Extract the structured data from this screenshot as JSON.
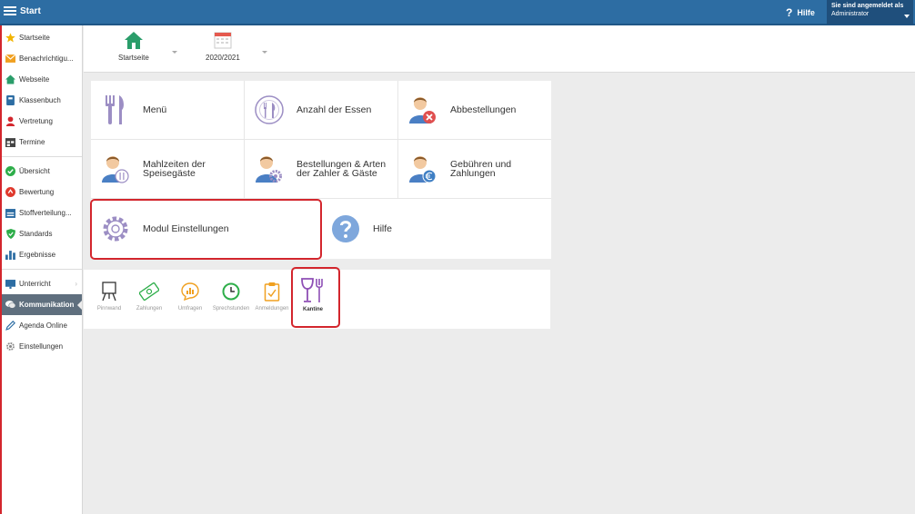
{
  "topbar": {
    "title": "Start",
    "help_label": "Hilfe",
    "help_glyph": "?",
    "user_label": "Sie sind angemeldet als",
    "user_name": "Administrator"
  },
  "sidebar": {
    "items": [
      {
        "label": "Startseite",
        "icon": "star-icon",
        "color": "#f2b400"
      },
      {
        "label": "Benachrichtigu...",
        "icon": "mail-icon",
        "color": "#f0a020"
      },
      {
        "label": "Webseite",
        "icon": "home-icon",
        "color": "#2a9d6a"
      },
      {
        "label": "Klassenbuch",
        "icon": "book-icon",
        "color": "#2d6da3"
      },
      {
        "label": "Vertretung",
        "icon": "person-icon",
        "color": "#d3262d"
      },
      {
        "label": "Termine",
        "icon": "calendar-icon",
        "color": "#444444"
      },
      {
        "label": "Übersicht",
        "icon": "check-circle-icon",
        "color": "#2eae4a"
      },
      {
        "label": "Bewertung",
        "icon": "rating-icon",
        "color": "#e03a2e"
      },
      {
        "label": "Stoffverteilung...",
        "icon": "list-icon",
        "color": "#2d6da3"
      },
      {
        "label": "Standards",
        "icon": "shield-icon",
        "color": "#2eae4a"
      },
      {
        "label": "Ergebnisse",
        "icon": "bar-chart-icon",
        "color": "#2d6da3"
      },
      {
        "label": "Unterricht",
        "icon": "board-icon",
        "color": "#2d6da3"
      },
      {
        "label": "Kommunikation",
        "icon": "chat-icon",
        "color": "#ffffff"
      },
      {
        "label": "Agenda Online",
        "icon": "pen-icon",
        "color": "#2d6da3"
      },
      {
        "label": "Einstellungen",
        "icon": "gear-icon",
        "color": "#888888"
      }
    ],
    "arrow": "›"
  },
  "header": {
    "home_label": "Startseite",
    "year_label": "2020/2021"
  },
  "tiles": [
    {
      "label": "Menü"
    },
    {
      "label": "Anzahl der Essen"
    },
    {
      "label": "Abbestellungen"
    },
    {
      "label": "Mahlzeiten der Speisegäste"
    },
    {
      "label": "Bestellungen & Arten der Zahler & Gäste"
    },
    {
      "label": "Gebühren und Zahlungen"
    },
    {
      "label": "Modul Einstellungen"
    },
    {
      "label": "Hilfe"
    }
  ],
  "apps": [
    {
      "label": "Pinnwand"
    },
    {
      "label": "Zahlungen"
    },
    {
      "label": "Umfragen"
    },
    {
      "label": "Sprechstunden"
    },
    {
      "label": "Anmeldungen"
    },
    {
      "label": "Kantine"
    }
  ],
  "colors": {
    "topbar": "#2d6da3",
    "highlight": "#d3262d",
    "kantine": "#8e4fb5",
    "tile_icon": "#8b7fb8"
  }
}
